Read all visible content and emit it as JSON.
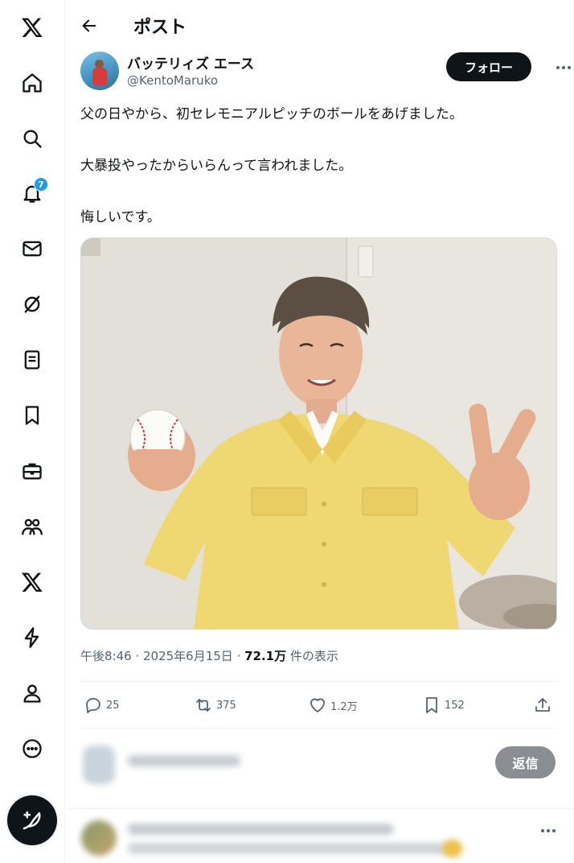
{
  "nav": {
    "items": [
      {
        "name": "x-logo-icon"
      },
      {
        "name": "home-icon"
      },
      {
        "name": "search-icon"
      },
      {
        "name": "notifications-icon",
        "badge": "7"
      },
      {
        "name": "messages-icon"
      },
      {
        "name": "grok-icon"
      },
      {
        "name": "lists-icon"
      },
      {
        "name": "bookmarks-icon"
      },
      {
        "name": "jobs-icon"
      },
      {
        "name": "communities-icon"
      },
      {
        "name": "premium-icon"
      },
      {
        "name": "verified-orgs-icon"
      },
      {
        "name": "profile-icon"
      },
      {
        "name": "more-icon"
      }
    ],
    "notification_badge": "7",
    "compose_icon": "compose-icon"
  },
  "header": {
    "title": "ポスト"
  },
  "post": {
    "author": {
      "display_name": "バッテリィズ エース",
      "handle": "@KentoMaruko"
    },
    "follow_label": "フォロー",
    "text": {
      "line1": "父の日やから、初セレモニアルピッチのボールをあげました。",
      "line2": "大暴投やったからいらんって言われました。",
      "line3": "悔しいです。"
    },
    "meta": {
      "timestamp": "午後8:46 · 2025年6月15日",
      "separator": " · ",
      "views_count": "72.1万",
      "views_label": " 件の表示"
    },
    "actions": {
      "replies": "25",
      "reposts": "375",
      "likes": "1.2万",
      "bookmarks": "152"
    }
  },
  "reply": {
    "button_label": "返信"
  },
  "colors": {
    "text": "#0f1419",
    "secondary": "#536471",
    "accent": "#1d9bf0",
    "border": "#eff3f4"
  }
}
